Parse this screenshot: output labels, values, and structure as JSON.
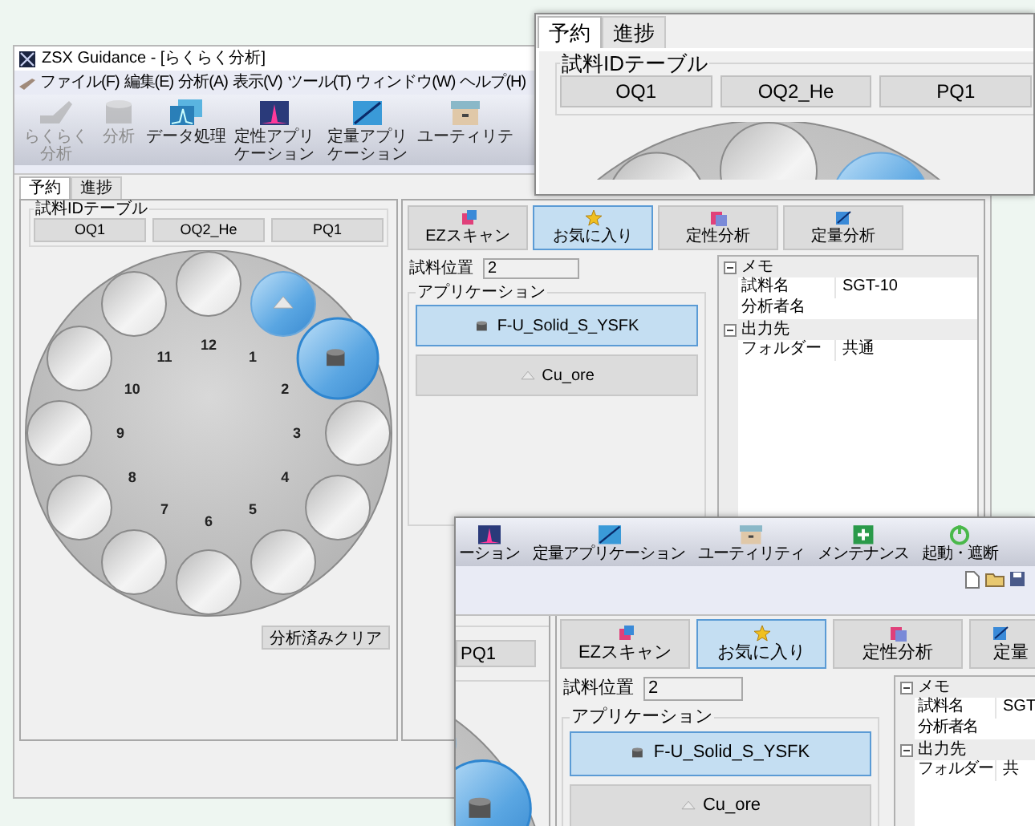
{
  "main_window": {
    "title": "ZSX Guidance - [らくらく分析]",
    "menu": [
      "ファイル(F)",
      "編集(E)",
      "分析(A)",
      "表示(V)",
      "ツール(T)",
      "ウィンドウ(W)",
      "ヘルプ(H)"
    ],
    "toolbar": [
      {
        "label": "らくらく分析",
        "kind": "hand",
        "disabled": true
      },
      {
        "label": "分析",
        "kind": "cylinder",
        "disabled": true
      },
      {
        "label": "データ処理",
        "kind": "spectra",
        "disabled": false
      },
      {
        "label": "定性アプリケーション",
        "kind": "peak",
        "disabled": false
      },
      {
        "label": "定量アプリケーション",
        "kind": "calibration",
        "disabled": false
      },
      {
        "label": "ユーティリテ",
        "kind": "box",
        "disabled": false
      }
    ],
    "tabs": [
      {
        "label": "予約",
        "selected": true
      },
      {
        "label": "進捗",
        "selected": false
      }
    ],
    "sample_id_table": {
      "title": "試料IDテーブル",
      "items": [
        "OQ1",
        "OQ2_He",
        "PQ1"
      ]
    },
    "carousel": {
      "positions": [
        {
          "label": "1",
          "kind": "cone",
          "selected": false
        },
        {
          "label": "2",
          "kind": "cylinder",
          "selected": true
        },
        {
          "label": "3",
          "kind": "empty",
          "selected": false
        },
        {
          "label": "4",
          "kind": "empty",
          "selected": false
        },
        {
          "label": "5",
          "kind": "empty",
          "selected": false
        },
        {
          "label": "6",
          "kind": "empty",
          "selected": false
        },
        {
          "label": "7",
          "kind": "empty",
          "selected": false
        },
        {
          "label": "8",
          "kind": "empty",
          "selected": false
        },
        {
          "label": "9",
          "kind": "empty",
          "selected": false
        },
        {
          "label": "10",
          "kind": "empty",
          "selected": false
        },
        {
          "label": "11",
          "kind": "empty",
          "selected": false
        },
        {
          "label": "12",
          "kind": "empty",
          "selected": false
        }
      ]
    },
    "clear_button": "分析済みクリア",
    "method_tabs": [
      {
        "label": "EZスキャン",
        "kind": "scan",
        "selected": false
      },
      {
        "label": "お気に入り",
        "kind": "star",
        "selected": true
      },
      {
        "label": "定性分析",
        "kind": "qualitative",
        "selected": false
      },
      {
        "label": "定量分析",
        "kind": "quantitative",
        "selected": false
      }
    ],
    "sample_position": {
      "label": "試料位置",
      "value": "2"
    },
    "applications": {
      "title": "アプリケーション",
      "items": [
        {
          "label": "F-U_Solid_S_YSFK",
          "kind": "cylinder",
          "selected": true
        },
        {
          "label": "Cu_ore",
          "kind": "cone",
          "selected": false
        }
      ]
    },
    "properties": [
      {
        "category": "メモ",
        "expanded": true,
        "rows": [
          {
            "name": "試料名",
            "value": "SGT-10"
          },
          {
            "name": "分析者名"
          }
        ]
      },
      {
        "category": "出力先",
        "expanded": true,
        "rows": [
          {
            "name": "フォルダー",
            "value": "共通"
          }
        ]
      }
    ]
  },
  "zoom_top": {
    "tabs": [
      {
        "label": "予約",
        "selected": true
      },
      {
        "label": "進捗",
        "selected": false
      }
    ],
    "sample_id_table": {
      "title": "試料IDテーブル",
      "items": [
        "OQ1",
        "OQ2_He",
        "PQ1"
      ]
    }
  },
  "zoom_bottom": {
    "toolbar": [
      {
        "label": "ーション",
        "kind": "peak"
      },
      {
        "label": "定量アプリケーション",
        "kind": "calibration"
      },
      {
        "label": "ユーティリティ",
        "kind": "box"
      },
      {
        "label": "メンテナンス",
        "kind": "plus"
      },
      {
        "label": "起動・遮断",
        "kind": "power"
      }
    ],
    "sample_id_table": {
      "items": [
        "PQ1"
      ]
    },
    "method_tabs": [
      {
        "label": "EZスキャン",
        "kind": "scan",
        "selected": false
      },
      {
        "label": "お気に入り",
        "kind": "star",
        "selected": true
      },
      {
        "label": "定性分析",
        "kind": "qualitative",
        "selected": false
      },
      {
        "label": "定量",
        "kind": "quantitative",
        "selected": false
      }
    ],
    "sample_position": {
      "label": "試料位置",
      "value": "2"
    },
    "applications": {
      "title": "アプリケーション",
      "items": [
        {
          "label": "F-U_Solid_S_YSFK",
          "kind": "cylinder",
          "selected": true
        },
        {
          "label": "Cu_ore",
          "kind": "cone",
          "selected": false
        }
      ]
    },
    "properties": [
      {
        "category": "メモ",
        "expanded": true,
        "rows": [
          {
            "name": "試料名",
            "value": "SGT"
          },
          {
            "name": "分析者名"
          }
        ]
      },
      {
        "category": "出力先",
        "expanded": true,
        "rows": [
          {
            "name": "フォルダー",
            "value": "共"
          }
        ]
      }
    ]
  }
}
